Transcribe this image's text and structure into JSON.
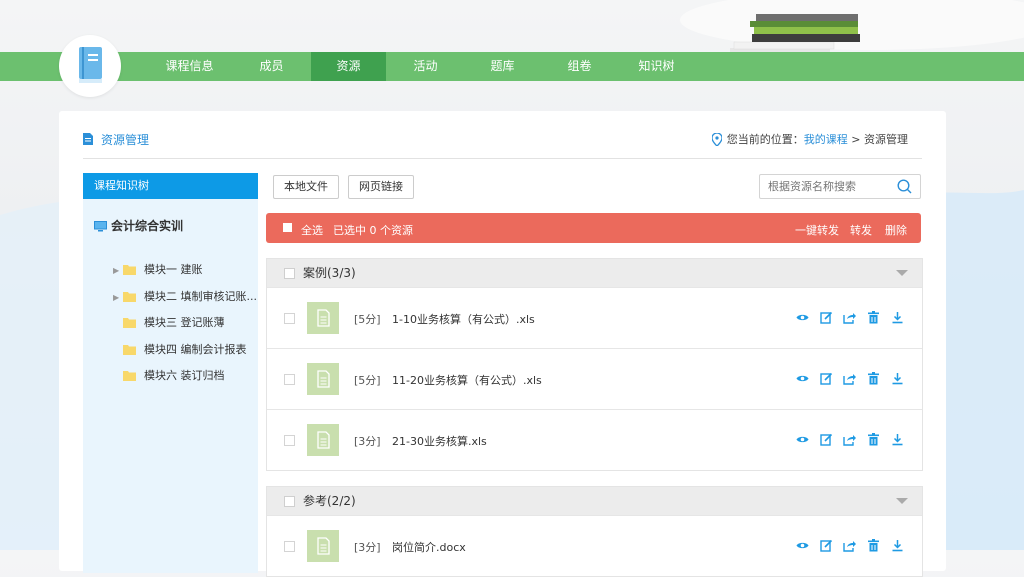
{
  "nav": {
    "items": [
      {
        "label": "课程信息"
      },
      {
        "label": "成员"
      },
      {
        "label": "资源"
      },
      {
        "label": "活动"
      },
      {
        "label": "题库"
      },
      {
        "label": "组卷"
      },
      {
        "label": "知识树"
      }
    ],
    "active": "资源"
  },
  "page": {
    "title": "资源管理",
    "breadcrumb_prefix": "您当前的位置：",
    "breadcrumb_link": "我的课程",
    "breadcrumb_sep": ">",
    "breadcrumb_current": "资源管理"
  },
  "sidebar": {
    "header": "课程知识树",
    "root": "会计综合实训",
    "items": [
      {
        "label": "模块一 建账",
        "expandable": true
      },
      {
        "label": "模块二 填制审核记账...",
        "expandable": true
      },
      {
        "label": "模块三 登记账薄",
        "expandable": false
      },
      {
        "label": "模块四 编制会计报表",
        "expandable": false
      },
      {
        "label": "模块六 装订归档",
        "expandable": false
      }
    ]
  },
  "toolbar": {
    "local_file": "本地文件",
    "web_link": "网页链接",
    "search_placeholder": "根据资源名称搜索"
  },
  "actionbar": {
    "select_all": "全选",
    "selected_text": "已选中 0 个资源",
    "one_click_forward": "一键转发",
    "forward": "转发",
    "delete": "删除"
  },
  "groups": [
    {
      "title": "案例(3/3)",
      "rows": [
        {
          "score": "[5分]",
          "name": "1-10业务核算（有公式）.xls"
        },
        {
          "score": "[5分]",
          "name": "11-20业务核算（有公式）.xls"
        },
        {
          "score": "[3分]",
          "name": "21-30业务核算.xls"
        }
      ]
    },
    {
      "title": "参考(2/2)",
      "rows": [
        {
          "score": "[3分]",
          "name": "岗位简介.docx"
        }
      ]
    }
  ],
  "colors": {
    "nav_green": "#6cc06f",
    "nav_active": "#3fa14f",
    "accent_blue": "#0d9ae6",
    "action_red": "#eb6a5c",
    "thumb_green": "#c9dfae"
  }
}
